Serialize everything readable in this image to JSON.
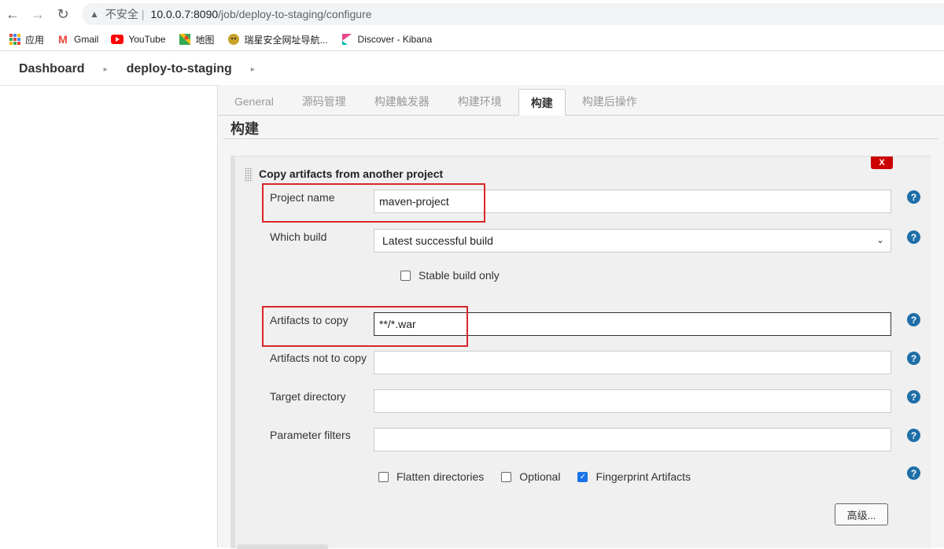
{
  "browser": {
    "nav": {
      "back": "←",
      "forward": "→",
      "reload": "↻"
    },
    "insecure_label": "不安全",
    "url_host": "10.0.0.7:8090",
    "url_path": "/job/deploy-to-staging/configure",
    "bookmarks": [
      {
        "label": "应用",
        "icon": "apps-grid-icon"
      },
      {
        "label": "Gmail",
        "icon": "gmail-icon"
      },
      {
        "label": "YouTube",
        "icon": "youtube-icon"
      },
      {
        "label": "地图",
        "icon": "maps-icon"
      },
      {
        "label": "瑞星安全网址导航...",
        "icon": "rising-icon"
      },
      {
        "label": "Discover - Kibana",
        "icon": "kibana-icon"
      }
    ]
  },
  "breadcrumb": {
    "items": [
      "Dashboard",
      "deploy-to-staging"
    ]
  },
  "tabs": [
    {
      "label": "General",
      "active": false
    },
    {
      "label": "源码管理",
      "active": false
    },
    {
      "label": "构建触发器",
      "active": false
    },
    {
      "label": "构建环境",
      "active": false
    },
    {
      "label": "构建",
      "active": true
    },
    {
      "label": "构建后操作",
      "active": false
    }
  ],
  "section": {
    "title": "构建"
  },
  "builder": {
    "title": "Copy artifacts from another project",
    "delete_label": "X",
    "fields": {
      "project_name": {
        "label": "Project name",
        "value": "maven-project"
      },
      "which_build": {
        "label": "Which build",
        "value": "Latest successful build"
      },
      "stable_only": {
        "label": "Stable build only",
        "checked": false
      },
      "artifacts_to_copy": {
        "label": "Artifacts to copy",
        "value": "**/*.war"
      },
      "artifacts_not_to_copy": {
        "label": "Artifacts not to copy",
        "value": ""
      },
      "target_directory": {
        "label": "Target directory",
        "value": ""
      },
      "parameter_filters": {
        "label": "Parameter filters",
        "value": ""
      }
    },
    "options": {
      "flatten": {
        "label": "Flatten directories",
        "checked": false
      },
      "optional": {
        "label": "Optional",
        "checked": false
      },
      "fingerprint": {
        "label": "Fingerprint Artifacts",
        "checked": true
      }
    },
    "advanced_label": "高级...",
    "help_glyph": "?"
  },
  "colors": {
    "highlight": "#d9262a",
    "help": "#1f6ea8",
    "delete": "#cc0000",
    "checked": "#1a73e8"
  }
}
